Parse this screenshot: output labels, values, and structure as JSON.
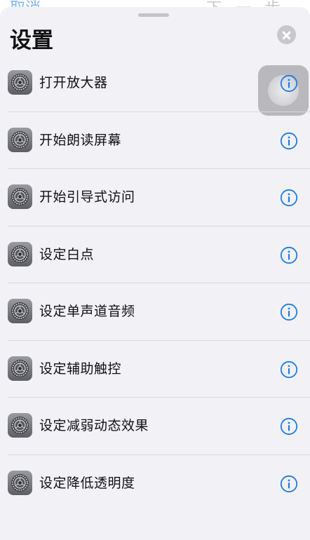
{
  "backdrop": {
    "cancel_label": "取消",
    "next_label": "下一步"
  },
  "sheet": {
    "title": "设置"
  },
  "actions": [
    {
      "label": "打开放大器",
      "icon": "settings-gear-icon",
      "info_icon": "info-icon",
      "pressed": true
    },
    {
      "label": "开始朗读屏幕",
      "icon": "settings-gear-icon",
      "info_icon": "info-icon"
    },
    {
      "label": "开始引导式访问",
      "icon": "settings-gear-icon",
      "info_icon": "info-icon"
    },
    {
      "label": "设定白点",
      "icon": "settings-gear-icon",
      "info_icon": "info-icon"
    },
    {
      "label": "设定单声道音频",
      "icon": "settings-gear-icon",
      "info_icon": "info-icon"
    },
    {
      "label": "设定辅助触控",
      "icon": "settings-gear-icon",
      "info_icon": "info-icon"
    },
    {
      "label": "设定减弱动态效果",
      "icon": "settings-gear-icon",
      "info_icon": "info-icon"
    },
    {
      "label": "设定降低透明度",
      "icon": "settings-gear-icon",
      "info_icon": "info-icon"
    }
  ],
  "colors": {
    "accent": "#1a7cf0",
    "sheet_background": "#f2f1f6",
    "divider": "#d9d8dd"
  }
}
